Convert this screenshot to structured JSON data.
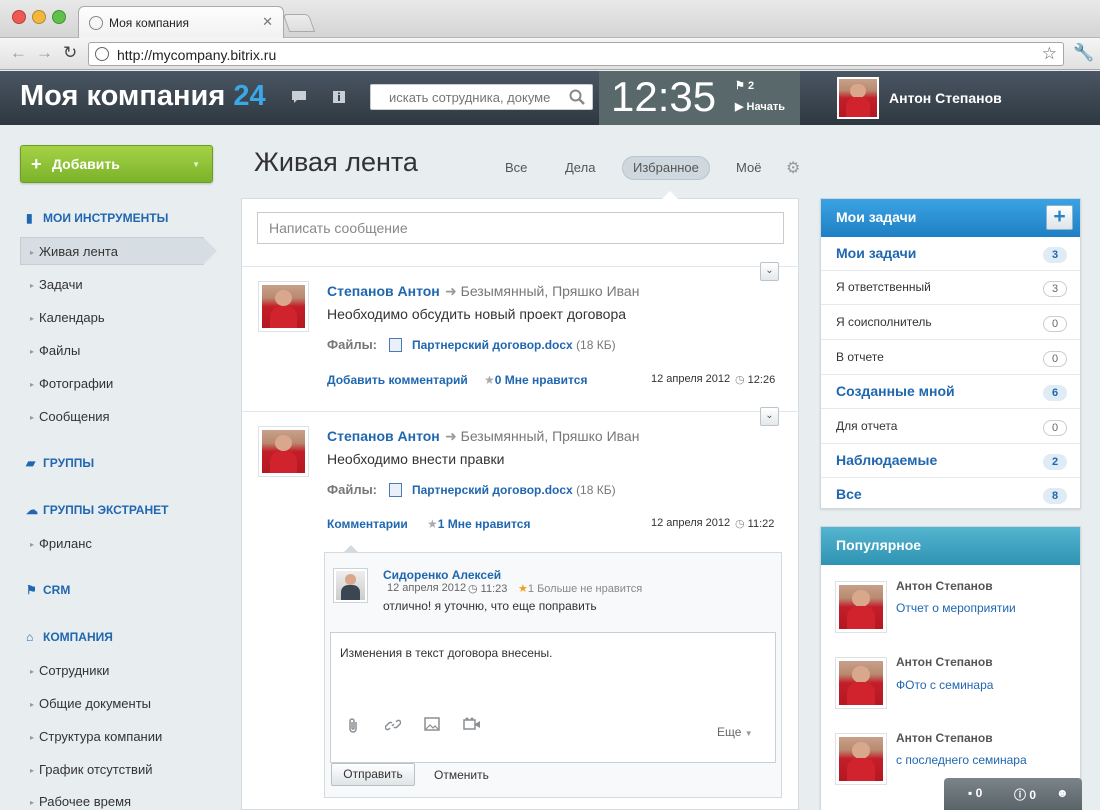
{
  "browser": {
    "tab_title": "Моя компания",
    "url": "http://mycompany.bitrix.ru"
  },
  "header": {
    "logo_text": "Моя компания",
    "logo_number": "24",
    "search_placeholder": "искать сотрудника, докуме",
    "clock": "12:35",
    "tasks_flag_count": "2",
    "start_label": "Начать",
    "user_name": "Антон Степанов"
  },
  "sidebar": {
    "add_label": "Добавить",
    "sections": [
      {
        "title": "МОИ ИНСТРУМЕНТЫ",
        "items": [
          "Живая лента",
          "Задачи",
          "Календарь",
          "Файлы",
          "Фотографии",
          "Сообщения"
        ]
      },
      {
        "title": "ГРУППЫ",
        "items": []
      },
      {
        "title": "ГРУППЫ ЭКСТРАНЕТ",
        "items": [
          "Фриланс"
        ]
      },
      {
        "title": "CRM",
        "items": []
      },
      {
        "title": "КОМПАНИЯ",
        "items": [
          "Сотрудники",
          "Общие документы",
          "Структура компании",
          "График отсутствий",
          "Рабочее время"
        ]
      }
    ]
  },
  "feed": {
    "title": "Живая лента",
    "tabs": [
      "Все",
      "Дела",
      "Избранное",
      "Моё"
    ],
    "active_tab": "Избранное",
    "compose_placeholder": "Написать сообщение",
    "files_label": "Файлы:",
    "posts": [
      {
        "author": "Степанов Антон",
        "destination": "Безымянный, Пряшко Иван",
        "text": "Необходимо обсудить новый проект договора",
        "file_name": "Партнерский договор.docx",
        "file_size": "(18 КБ)",
        "comment_link": "Добавить комментарий",
        "like_count": "0",
        "like_label": "Мне нравится",
        "date": "12 апреля 2012",
        "time": "12:26"
      },
      {
        "author": "Степанов Антон",
        "destination": "Безымянный, Пряшко Иван",
        "text": "Необходимо внести правки",
        "file_name": "Партнерский договор.docx",
        "file_size": "(18 КБ)",
        "comment_link": "Комментарии",
        "like_count": "1",
        "like_label": "Мне нравится",
        "date": "12 апреля 2012",
        "time": "11:22"
      }
    ],
    "comment": {
      "author": "Сидоренко Алексей",
      "date": "12 апреля 2012",
      "time": "11:23",
      "like_count": "1",
      "like_label": "Больше не нравится",
      "text": "отлично! я уточню, что еще поправить"
    },
    "reply": {
      "text": "Изменения в текст договора внесены.",
      "more_label": "Еще",
      "send_label": "Отправить",
      "cancel_label": "Отменить"
    }
  },
  "tasks_widget": {
    "title": "Мои задачи",
    "rows": [
      {
        "label": "Мои задачи",
        "count": "3",
        "bold": true
      },
      {
        "label": "Я ответственный",
        "count": "3",
        "bold": false
      },
      {
        "label": "Я соисполнитель",
        "count": "0",
        "bold": false
      },
      {
        "label": "В отчете",
        "count": "0",
        "bold": false
      },
      {
        "label": "Созданные мной",
        "count": "6",
        "bold": true
      },
      {
        "label": "Для отчета",
        "count": "0",
        "bold": false
      },
      {
        "label": "Наблюдаемые",
        "count": "2",
        "bold": true
      },
      {
        "label": "Все",
        "count": "8",
        "bold": true
      }
    ]
  },
  "popular_widget": {
    "title": "Популярное",
    "items": [
      {
        "author": "Антон Степанов",
        "link": "Отчет о мероприятии"
      },
      {
        "author": "Антон Степанов",
        "link": "ФОто с семинара"
      },
      {
        "author": "Антон Степанов",
        "link": "с последнего семинара"
      }
    ]
  },
  "bottom_bar": {
    "messages_count": "0",
    "notifications_count": "0"
  },
  "colors": {
    "accent": "#2067b0",
    "add_button": "#8fc13a",
    "header_bg": "#3a4550",
    "widget_tasks_header": "#2a8ad0",
    "widget_popular_header": "#3aa0bd"
  }
}
